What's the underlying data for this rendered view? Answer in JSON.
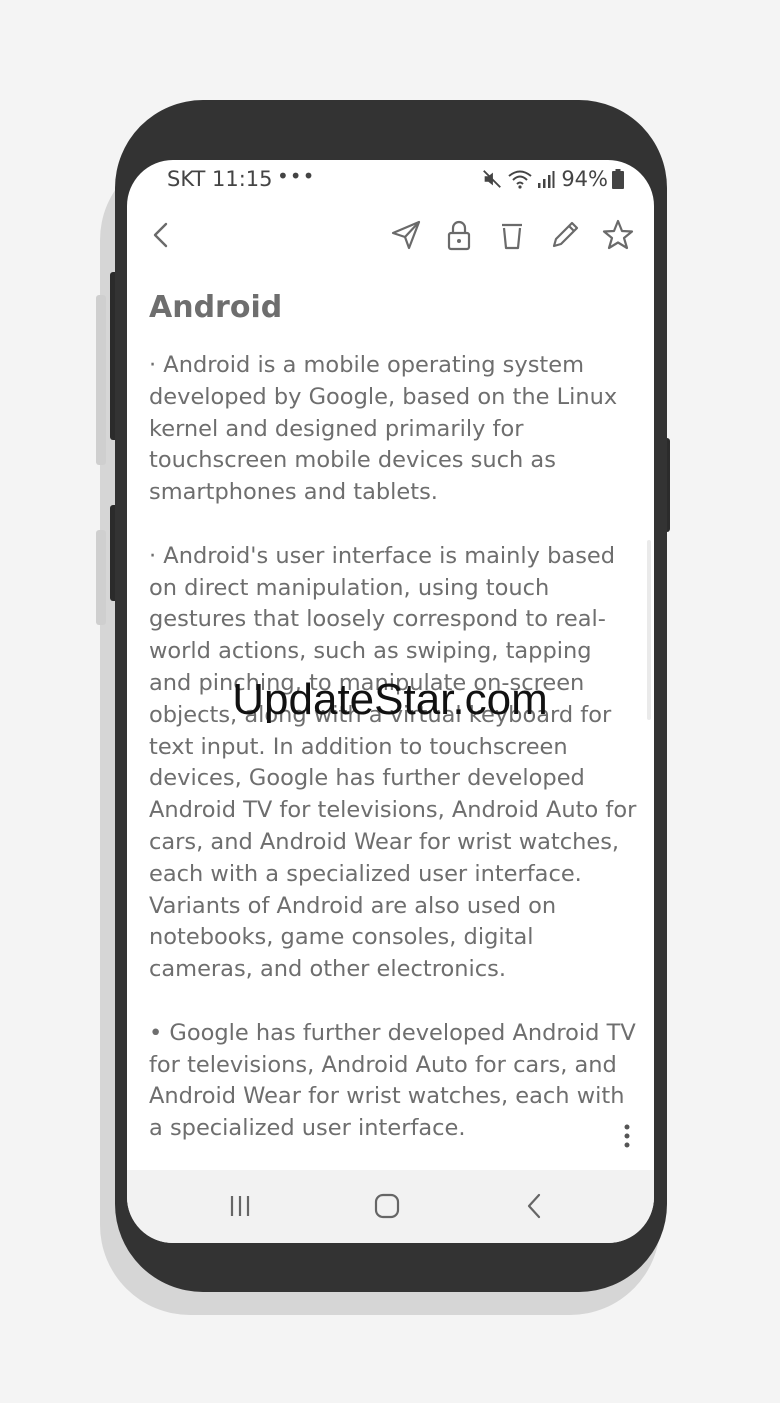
{
  "status_bar": {
    "carrier_time": "SKT 11:15",
    "more_dots": "•••",
    "battery": "94%"
  },
  "toolbar": {
    "icons": [
      "back-icon",
      "share-icon",
      "lock-icon",
      "delete-icon",
      "edit-icon",
      "favorite-icon"
    ]
  },
  "note": {
    "title": "Android",
    "paragraphs": [
      "· Android is a mobile operating system developed by Google, based on the Linux kernel and designed primarily for touchscreen mobile devices such as smartphones and tablets.",
      "· Android's user interface is mainly based on direct manipulation, using touch gestures that loosely correspond to real-world actions, such as swiping, tapping and pinching, to manipulate on-screen objects, along with a virtual keyboard for text input. In addition to touchscreen devices, Google has further developed Android TV for televisions, Android Auto for cars, and Android Wear for wrist watches, each with a specialized user interface. Variants of Android are also used on notebooks, game consoles, digital cameras, and other electronics.",
      "• Google has further developed Android TV for televisions, Android Auto for cars, and Android Wear for wrist watches, each with a specialized user interface."
    ]
  },
  "nav_bar": {
    "icons": [
      "recent-apps-icon",
      "home-icon",
      "back-nav-icon"
    ]
  },
  "watermark": "UpdateStar.com",
  "colors": {
    "background": "#f4f4f4",
    "phone_frame": "#333333",
    "text": "#6e6e6e",
    "icon": "#6a6a6a",
    "nav_bar": "#f2f2f2"
  }
}
